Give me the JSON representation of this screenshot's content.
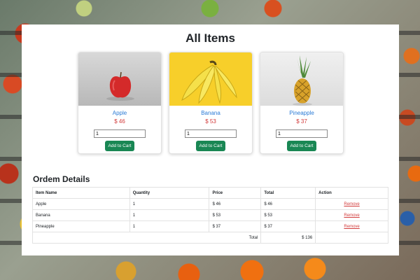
{
  "page": {
    "title": "All Items",
    "accent_color": "#198754",
    "link_color": "#2b7bd6",
    "price_color": "#d23b3b"
  },
  "products": [
    {
      "name": "Apple",
      "price": "$ 46",
      "qty": "1",
      "button_label": "Add to Cart",
      "image_icon": "apple-icon"
    },
    {
      "name": "Banana",
      "price": "$ 53",
      "qty": "1",
      "button_label": "Add to Cart",
      "image_icon": "banana-icon"
    },
    {
      "name": "Pineapple",
      "price": "$ 37",
      "qty": "1",
      "button_label": "Add to Cart",
      "image_icon": "pineapple-icon"
    }
  ],
  "order": {
    "title": "Ordem Details",
    "columns": [
      "Item Name",
      "Quantity",
      "Price",
      "Total",
      "Action"
    ],
    "rows": [
      {
        "name": "Apple",
        "quantity": "1",
        "price": "$ 46",
        "total": "$ 46",
        "action": "Remove"
      },
      {
        "name": "Banana",
        "quantity": "1",
        "price": "$ 53",
        "total": "$ 53",
        "action": "Remove"
      },
      {
        "name": "Pineapple",
        "quantity": "1",
        "price": "$ 37",
        "total": "$ 37",
        "action": "Remove"
      }
    ],
    "total_label": "Total",
    "total_value": "$ 136"
  }
}
